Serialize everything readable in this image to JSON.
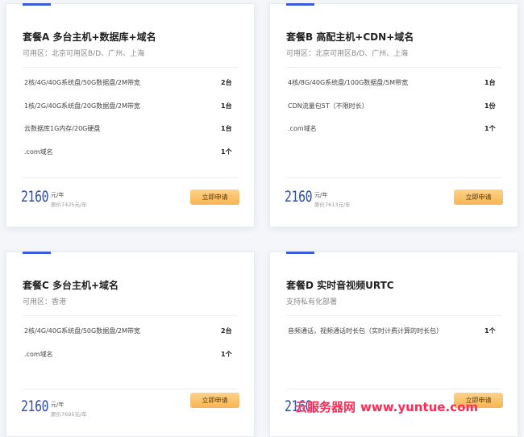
{
  "cards": [
    {
      "title": "套餐A 多台主机+数据库+域名",
      "subtitle": "可用区：北京可用区B/D、广州、上海",
      "items": [
        {
          "name": "2核/4G/40G系统盘/50G数据盘/2M带宽",
          "qty": "2台"
        },
        {
          "name": "1核/2G/40G系统盘/20G数据盘/2M带宽",
          "qty": "1台"
        },
        {
          "name": "云数据库1G内存/20G硬盘",
          "qty": "1台"
        },
        {
          "name": ".com域名",
          "qty": "1个"
        }
      ],
      "price": "2160",
      "unit": "元/年",
      "original": "原价7425元/年",
      "button": "立即申请"
    },
    {
      "title": "套餐B 高配主机+CDN+域名",
      "subtitle": "可用区：北京可用区B/D、广州、上海",
      "items": [
        {
          "name": "4核/8G/40G系统盘/100G数据盘/5M带宽",
          "qty": "1台"
        },
        {
          "name": "CDN流量包5T（不限时长）",
          "qty": "1份"
        },
        {
          "name": ".com域名",
          "qty": "1个"
        }
      ],
      "price": "2160",
      "unit": "元/年",
      "original": "原价7613元/年",
      "button": "立即申请"
    },
    {
      "title": "套餐C 多台主机+域名",
      "subtitle": "可用区：香港",
      "items": [
        {
          "name": "2核/4G/40G系统盘/50G数据盘/2M带宽",
          "qty": "2台"
        },
        {
          "name": ".com域名",
          "qty": "1个"
        }
      ],
      "price": "2160",
      "unit": "元/年",
      "original": "原价7695元/年",
      "button": "立即申请"
    },
    {
      "title": "套餐D 实时音视频URTC",
      "subtitle": "支持私有化部署",
      "items": [
        {
          "name": "音频通话，视频通话时长包（实时计费计算的时长包）",
          "qty": "1个"
        }
      ],
      "price": "2160",
      "unit": "元/年",
      "original": "",
      "button": "立即申请"
    }
  ],
  "watermark": {
    "text_cn": "云服务器网",
    "url": "www.yuntue.com"
  },
  "colors": {
    "accent": "#3b5bdb",
    "price": "#2e4fb2",
    "button": "#f7b552",
    "watermark": "#ff2a55"
  }
}
